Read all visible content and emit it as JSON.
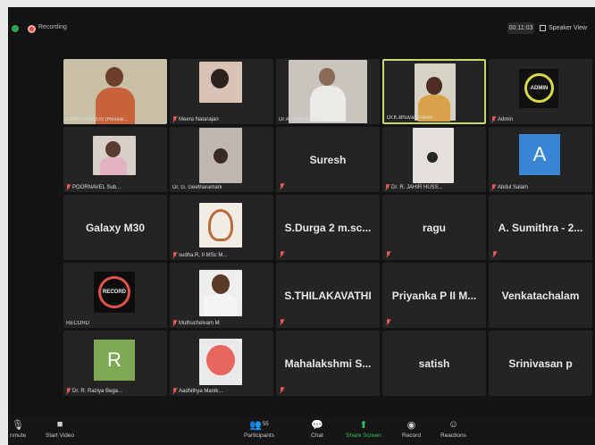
{
  "header": {
    "recording_label": "Recording",
    "timer": "00:11:03",
    "view_label": "Speaker View"
  },
  "tiles": [
    {
      "label": "CHARUVENUS (Resear...",
      "muted": false
    },
    {
      "label": "Meera Natarajan",
      "muted": true
    },
    {
      "label": "Dr A. SOLAIRAJU",
      "muted": false
    },
    {
      "label": "Dr.K.Bhuvaneswari",
      "muted": false
    },
    {
      "label": "Admin",
      "muted": true
    },
    {
      "label": "POORNAVEL Sub...",
      "muted": true
    },
    {
      "label": "Dr. G. Geetharamani",
      "muted": false
    },
    {
      "label": "Suresh",
      "muted": true
    },
    {
      "label": "Dr. R. JAHIR HUSS...",
      "muted": true
    },
    {
      "label": "Abdul Salam",
      "muted": true
    },
    {
      "label": "Galaxy M30",
      "muted": false
    },
    {
      "label": "sudha.R, II MSc M...",
      "muted": true
    },
    {
      "label": "S.Durga 2 m.sc...",
      "muted": true
    },
    {
      "label": "ragu",
      "muted": true
    },
    {
      "label": "A. Sumithra - 2...",
      "muted": true
    },
    {
      "label": "RECORD",
      "muted": false
    },
    {
      "label": "Muthuchelvam M",
      "muted": true
    },
    {
      "label": "S.THILAKAVATHI",
      "muted": true
    },
    {
      "label": "Priyanka P II M...",
      "muted": true
    },
    {
      "label": "Venkatachalam",
      "muted": false
    },
    {
      "label": "Dr. R. Raziya Bega...",
      "muted": true
    },
    {
      "label": "Aadhithya Manik...",
      "muted": true
    },
    {
      "label": "Mahalakshmi S...",
      "muted": true
    },
    {
      "label": "satish",
      "muted": false
    },
    {
      "label": "Srinivasan p",
      "muted": false
    }
  ],
  "avatars": {
    "admin_badge": "ADMIN",
    "record_badge": "RECORD",
    "abdul_letter": "A",
    "raziya_letter": "R"
  },
  "toolbar": {
    "unmute": "nmute",
    "start_video": "Start Video",
    "participants": "Participants",
    "participants_count": "55",
    "chat": "Chat",
    "share_screen": "Share Screen",
    "record": "Record",
    "reactions": "Reactions"
  },
  "colors": {
    "active_speaker_border": "#c7d96b",
    "share_screen_green": "#35c25a",
    "muted_red": "#e35b4f",
    "abdul_avatar": "#3a84d4",
    "raziya_avatar": "#7fa855"
  }
}
